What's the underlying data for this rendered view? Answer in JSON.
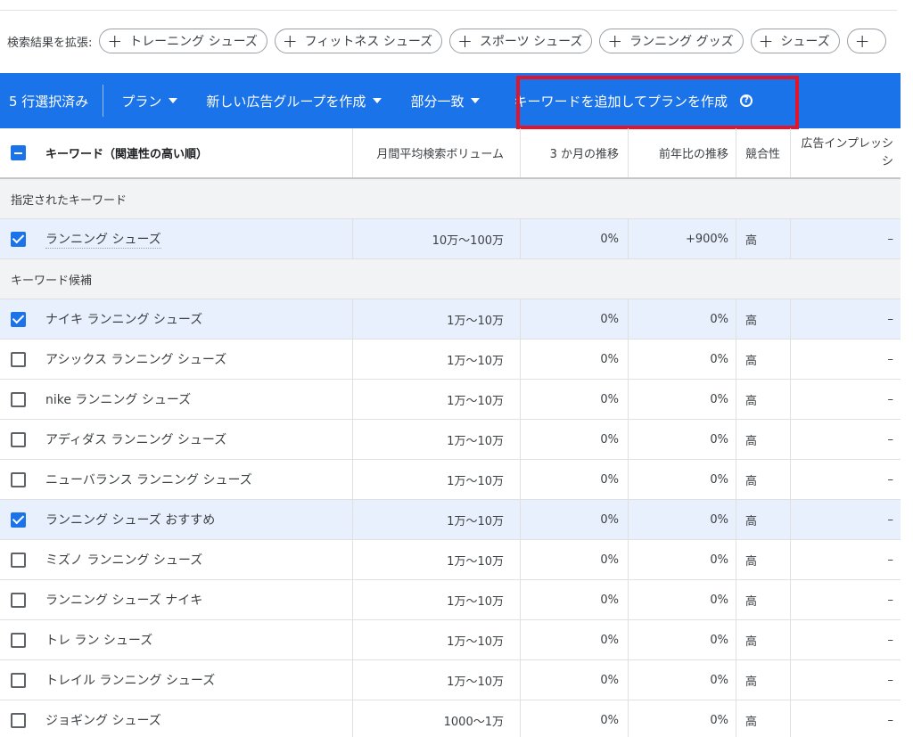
{
  "expand": {
    "label": "検索結果を拡張:",
    "chips": [
      "トレーニング シューズ",
      "フィットネス シューズ",
      "スポーツ シューズ",
      "ランニング グッズ",
      "シューズ",
      ""
    ]
  },
  "action_bar": {
    "selected": "5 行選択済み",
    "plan": "プラン",
    "new_group": "新しい広告グループを作成",
    "match": "部分一致",
    "add_keywords": "キーワードを追加してプランを作成",
    "help_icon": "?"
  },
  "headers": {
    "keyword": "キーワード（関連性の高い順）",
    "volume": "月間平均検索ボリューム",
    "trend_3m": "3 か月の推移",
    "yoy": "前年比の推移",
    "competition": "競合性",
    "impression_share_line1": "広告インプレッシ",
    "impression_share_line2": "シ"
  },
  "groups": {
    "specified": "指定されたキーワード",
    "candidates": "キーワード候補"
  },
  "specified_rows": [
    {
      "keyword": "ランニング シューズ",
      "volume": "10万～100万",
      "trend_3m": "0%",
      "yoy": "+900%",
      "competition": "高",
      "impression": "–",
      "checked": true
    }
  ],
  "candidate_rows": [
    {
      "keyword": "ナイキ ランニング シューズ",
      "volume": "1万～10万",
      "trend_3m": "0%",
      "yoy": "0%",
      "competition": "高",
      "impression": "–",
      "checked": true
    },
    {
      "keyword": "アシックス ランニング シューズ",
      "volume": "1万～10万",
      "trend_3m": "0%",
      "yoy": "0%",
      "competition": "高",
      "impression": "–",
      "checked": false
    },
    {
      "keyword": "nike ランニング シューズ",
      "volume": "1万～10万",
      "trend_3m": "0%",
      "yoy": "0%",
      "competition": "高",
      "impression": "–",
      "checked": false
    },
    {
      "keyword": "アディダス ランニング シューズ",
      "volume": "1万～10万",
      "trend_3m": "0%",
      "yoy": "0%",
      "competition": "高",
      "impression": "–",
      "checked": false
    },
    {
      "keyword": "ニューバランス ランニング シューズ",
      "volume": "1万～10万",
      "trend_3m": "0%",
      "yoy": "0%",
      "competition": "高",
      "impression": "–",
      "checked": false
    },
    {
      "keyword": "ランニング シューズ おすすめ",
      "volume": "1万～10万",
      "trend_3m": "0%",
      "yoy": "0%",
      "competition": "高",
      "impression": "–",
      "checked": true
    },
    {
      "keyword": "ミズノ ランニング シューズ",
      "volume": "1万～10万",
      "trend_3m": "0%",
      "yoy": "0%",
      "competition": "高",
      "impression": "–",
      "checked": false
    },
    {
      "keyword": "ランニング シューズ ナイキ",
      "volume": "1万～10万",
      "trend_3m": "0%",
      "yoy": "0%",
      "competition": "高",
      "impression": "–",
      "checked": false
    },
    {
      "keyword": "トレ ラン シューズ",
      "volume": "1万～10万",
      "trend_3m": "0%",
      "yoy": "0%",
      "competition": "高",
      "impression": "–",
      "checked": false
    },
    {
      "keyword": "トレイル ランニング シューズ",
      "volume": "1万～10万",
      "trend_3m": "0%",
      "yoy": "0%",
      "competition": "高",
      "impression": "–",
      "checked": false
    },
    {
      "keyword": "ジョギング シューズ",
      "volume": "1000～1万",
      "trend_3m": "0%",
      "yoy": "0%",
      "competition": "高",
      "impression": "–",
      "checked": false
    }
  ],
  "colors": {
    "accent": "#1a73e8",
    "selected_row": "#e8f0fe",
    "highlight": "#e0142a"
  }
}
